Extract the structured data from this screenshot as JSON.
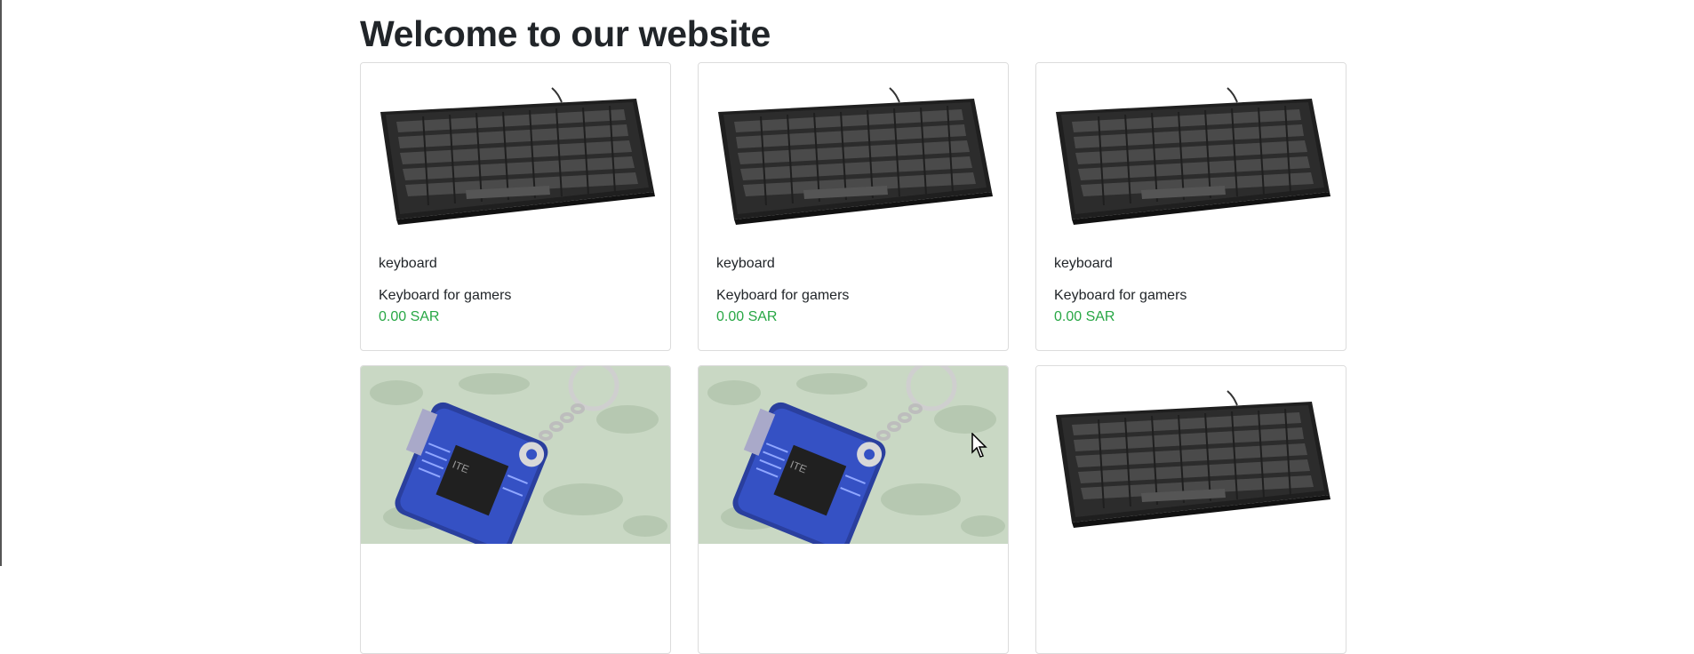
{
  "page": {
    "title": "Welcome to our website"
  },
  "colors": {
    "price": "#28a745",
    "text": "#212529",
    "card_border": "#dcdcdc"
  },
  "products": [
    {
      "image": "keyboard-image",
      "name": "keyboard",
      "description": "Keyboard for gamers",
      "price": "0.00 SAR"
    },
    {
      "image": "keyboard-image",
      "name": "keyboard",
      "description": "Keyboard for gamers",
      "price": "0.00 SAR"
    },
    {
      "image": "keyboard-image",
      "name": "keyboard",
      "description": "Keyboard for gamers",
      "price": "0.00 SAR"
    },
    {
      "image": "usb-keychain-image"
    },
    {
      "image": "usb-keychain-image"
    },
    {
      "image": "keyboard-image"
    }
  ]
}
